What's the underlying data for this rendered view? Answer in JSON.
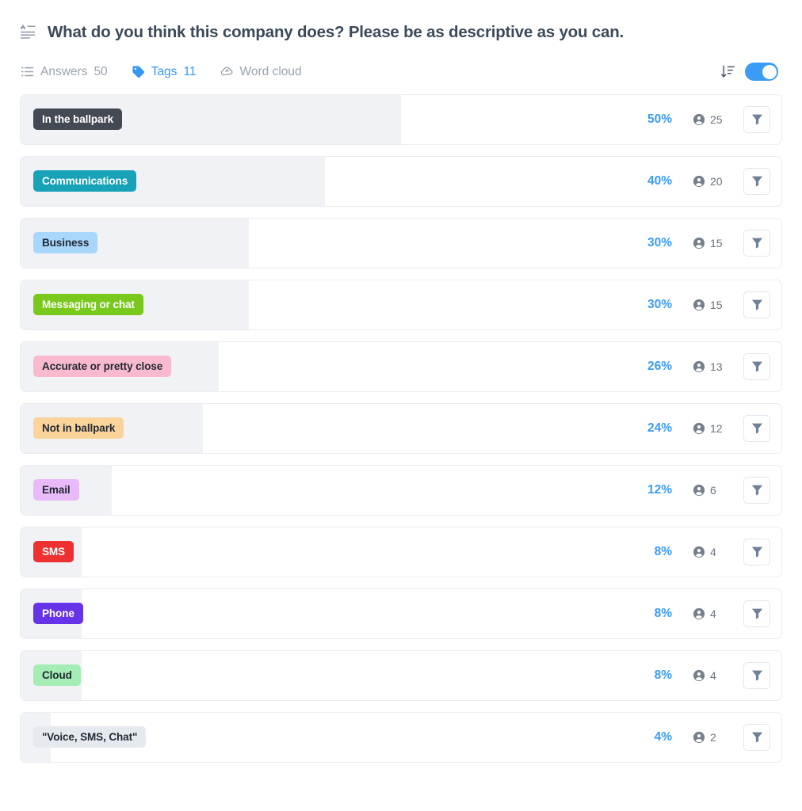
{
  "header": {
    "icon": "text-answer-icon",
    "question": "What do you think this company does? Please be as descriptive as you can."
  },
  "tabs": [
    {
      "icon": "list-icon",
      "label": "Answers",
      "count": "50",
      "active": false
    },
    {
      "icon": "tag-icon",
      "label": "Tags",
      "count": "11",
      "active": true
    },
    {
      "icon": "word-cloud-icon",
      "label": "Word cloud",
      "count": "",
      "active": false
    }
  ],
  "toolbar": {
    "sort_icon": "sort-descending-icon",
    "toggle_on": true,
    "accent_color": "#3b9cf5"
  },
  "row_controls": {
    "person_icon": "person-icon",
    "filter_icon": "filter-funnel-icon"
  },
  "chart_data": {
    "type": "bar",
    "title": "What do you think this company does? Please be as descriptive as you can.",
    "xlabel": "",
    "ylabel": "",
    "xlim": [
      0,
      100
    ],
    "grid": false,
    "legend": null,
    "orientation": "horizontal",
    "unit": "%",
    "total_responses": 50,
    "categories": [
      "In the ballpark",
      "Communications",
      "Business",
      "Messaging or chat",
      "Accurate or pretty close",
      "Not in ballpark",
      "Email",
      "SMS",
      "Phone",
      "Cloud",
      "\"Voice, SMS, Chat\""
    ],
    "values": [
      50,
      40,
      30,
      30,
      26,
      24,
      12,
      8,
      8,
      8,
      4
    ],
    "counts": [
      25,
      20,
      15,
      15,
      13,
      12,
      6,
      4,
      4,
      4,
      2
    ]
  },
  "rows": [
    {
      "label": "In the ballpark",
      "pct": "50%",
      "count": "25",
      "fill": 50,
      "bg": "#434a54",
      "fg": "#ffffff"
    },
    {
      "label": "Communications",
      "pct": "40%",
      "count": "20",
      "fill": 40,
      "bg": "#17a2b8",
      "fg": "#ffffff"
    },
    {
      "label": "Business",
      "pct": "30%",
      "count": "15",
      "fill": 30,
      "bg": "#a9d6fb",
      "fg": "#222a33"
    },
    {
      "label": "Messaging or chat",
      "pct": "30%",
      "count": "15",
      "fill": 30,
      "bg": "#78c91c",
      "fg": "#ffffff"
    },
    {
      "label": "Accurate or pretty close",
      "pct": "26%",
      "count": "13",
      "fill": 26,
      "bg": "#f9b9cf",
      "fg": "#222a33"
    },
    {
      "label": "Not in ballpark",
      "pct": "24%",
      "count": "12",
      "fill": 24,
      "bg": "#fbd49b",
      "fg": "#222a33"
    },
    {
      "label": "Email",
      "pct": "12%",
      "count": "6",
      "fill": 12,
      "bg": "#e8baf7",
      "fg": "#222a33"
    },
    {
      "label": "SMS",
      "pct": "8%",
      "count": "4",
      "fill": 8,
      "bg": "#ef3030",
      "fg": "#ffffff"
    },
    {
      "label": "Phone",
      "pct": "8%",
      "count": "4",
      "fill": 8,
      "bg": "#6633e8",
      "fg": "#ffffff"
    },
    {
      "label": "Cloud",
      "pct": "8%",
      "count": "4",
      "fill": 8,
      "bg": "#a5edb4",
      "fg": "#222a33"
    },
    {
      "label": "\"Voice, SMS, Chat\"",
      "pct": "4%",
      "count": "2",
      "fill": 4,
      "bg": "#e6e9ed",
      "fg": "#222a33"
    }
  ]
}
